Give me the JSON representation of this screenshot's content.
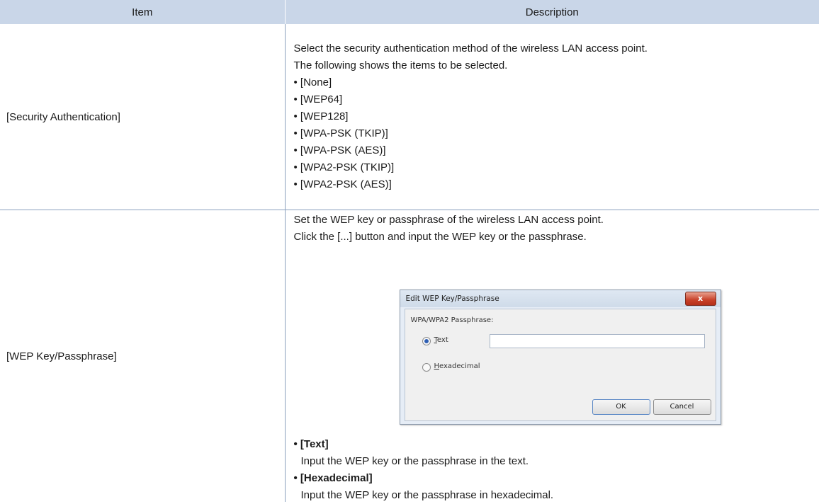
{
  "table": {
    "headers": {
      "item": "Item",
      "description": "Description"
    },
    "rows": [
      {
        "item": "[Security Authentication]",
        "description": [
          "Select the security authentication method of the wireless LAN access point.",
          "The following shows the items to be selected.",
          "• [None]",
          "• [WEP64]",
          "• [WEP128]",
          "• [WPA-PSK (TKIP)]",
          "• [WPA-PSK (AES)]",
          "• [WPA2-PSK (TKIP)]",
          "• [WPA2-PSK (AES)]"
        ]
      },
      {
        "item": "[WEP Key/Passphrase]",
        "description_intro": [
          "Set the WEP key or passphrase of the wireless LAN access point.",
          "Click the [...] button and input the WEP key or the passphrase."
        ],
        "description_items": [
          {
            "heading": "• [Text]",
            "text": "Input the WEP key or the passphrase in the text."
          },
          {
            "heading": "• [Hexadecimal]",
            "text": "Input the WEP key or the passphrase in hexadecimal."
          }
        ]
      }
    ]
  },
  "dialog": {
    "title": "Edit WEP Key/Passphrase",
    "close_label": "x",
    "group_label": "WPA/WPA2 Passphrase:",
    "options": [
      {
        "accel": "T",
        "rest": "ext",
        "checked": true
      },
      {
        "accel": "H",
        "rest": "exadecimal",
        "checked": false
      }
    ],
    "text_value": "",
    "ok_label": "OK",
    "cancel_label": "Cancel"
  },
  "colors": {
    "header_bg": "#c9d6e8",
    "rule": "#8aa0bd"
  }
}
